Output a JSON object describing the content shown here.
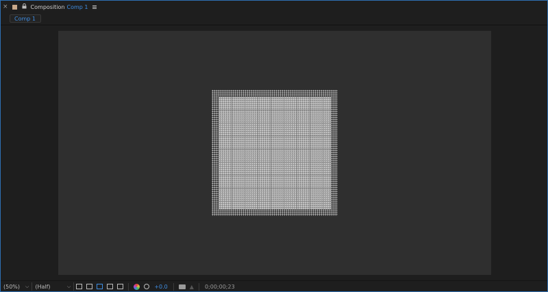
{
  "header": {
    "close_glyph": "×",
    "title": "Composition",
    "comp_name": "Comp 1",
    "swatch_color": "#c8a88a"
  },
  "tabs": [
    {
      "label": "Comp 1"
    }
  ],
  "bottombar": {
    "magnification": "(50%)",
    "resolution": "(Half)",
    "exposure": "+0.0",
    "timecode": "0;00;00;23"
  },
  "colors": {
    "accent": "#3f8ee3",
    "panel_border": "#2e6fb3",
    "canvas": "#2f2f2f"
  }
}
